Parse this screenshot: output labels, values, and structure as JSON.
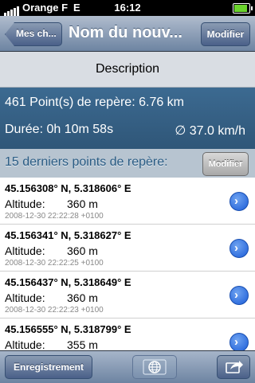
{
  "status_bar": {
    "carrier": "Orange F",
    "network": "E",
    "time": "16:12"
  },
  "nav": {
    "back_label": "Mes ch...",
    "title": "Nom du nouv...",
    "modify_label": "Modifier"
  },
  "description_label": "Description",
  "stats": {
    "points_text": "461 Point(s) de repère: 6.76 km",
    "duration_text": "Durée: 0h 10m 58s",
    "speed_text": "∅ 37.0 km/h"
  },
  "section": {
    "title": "15 derniers points de repère:",
    "modify_label": "Modifier"
  },
  "rows": [
    {
      "coord": "45.156308° N, 5.318606° E",
      "altitude_label": "Altitude:",
      "altitude": "360 m",
      "timestamp": "2008-12-30 22:22:28 +0100"
    },
    {
      "coord": "45.156341° N, 5.318627° E",
      "altitude_label": "Altitude:",
      "altitude": "360 m",
      "timestamp": "2008-12-30 22:22:25 +0100"
    },
    {
      "coord": "45.156437° N, 5.318649° E",
      "altitude_label": "Altitude:",
      "altitude": "360 m",
      "timestamp": "2008-12-30 22:22:23 +0100"
    },
    {
      "coord": "45.156555° N, 5.318799° E",
      "altitude_label": "Altitude:",
      "altitude": "355 m",
      "timestamp": ""
    }
  ],
  "toolbar": {
    "record_label": "Enregistrement"
  }
}
